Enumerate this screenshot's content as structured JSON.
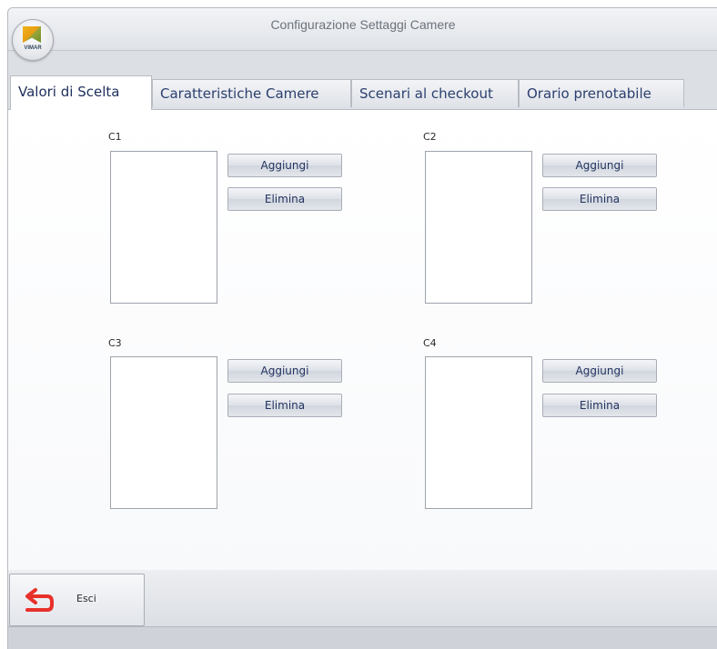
{
  "window": {
    "title": "Configurazione Settaggi Camere",
    "logo_text": "VIMAR"
  },
  "tabs": [
    {
      "label": "Valori di Scelta",
      "active": true
    },
    {
      "label": "Caratteristiche Camere",
      "active": false
    },
    {
      "label": "Scenari al checkout",
      "active": false
    },
    {
      "label": "Orario prenotabile",
      "active": false
    }
  ],
  "groups": [
    {
      "label": "C1",
      "add_label": "Aggiungi",
      "delete_label": "Elimina"
    },
    {
      "label": "C2",
      "add_label": "Aggiungi",
      "delete_label": "Elimina"
    },
    {
      "label": "C3",
      "add_label": "Aggiungi",
      "delete_label": "Elimina"
    },
    {
      "label": "C4",
      "add_label": "Aggiungi",
      "delete_label": "Elimina"
    }
  ],
  "footer": {
    "exit_label": "Esci",
    "exit_icon": "return-arrow-icon"
  },
  "colors": {
    "exit_icon": "#e8302a",
    "tab_text": "#2b3f6e",
    "button_text": "#22335f"
  }
}
